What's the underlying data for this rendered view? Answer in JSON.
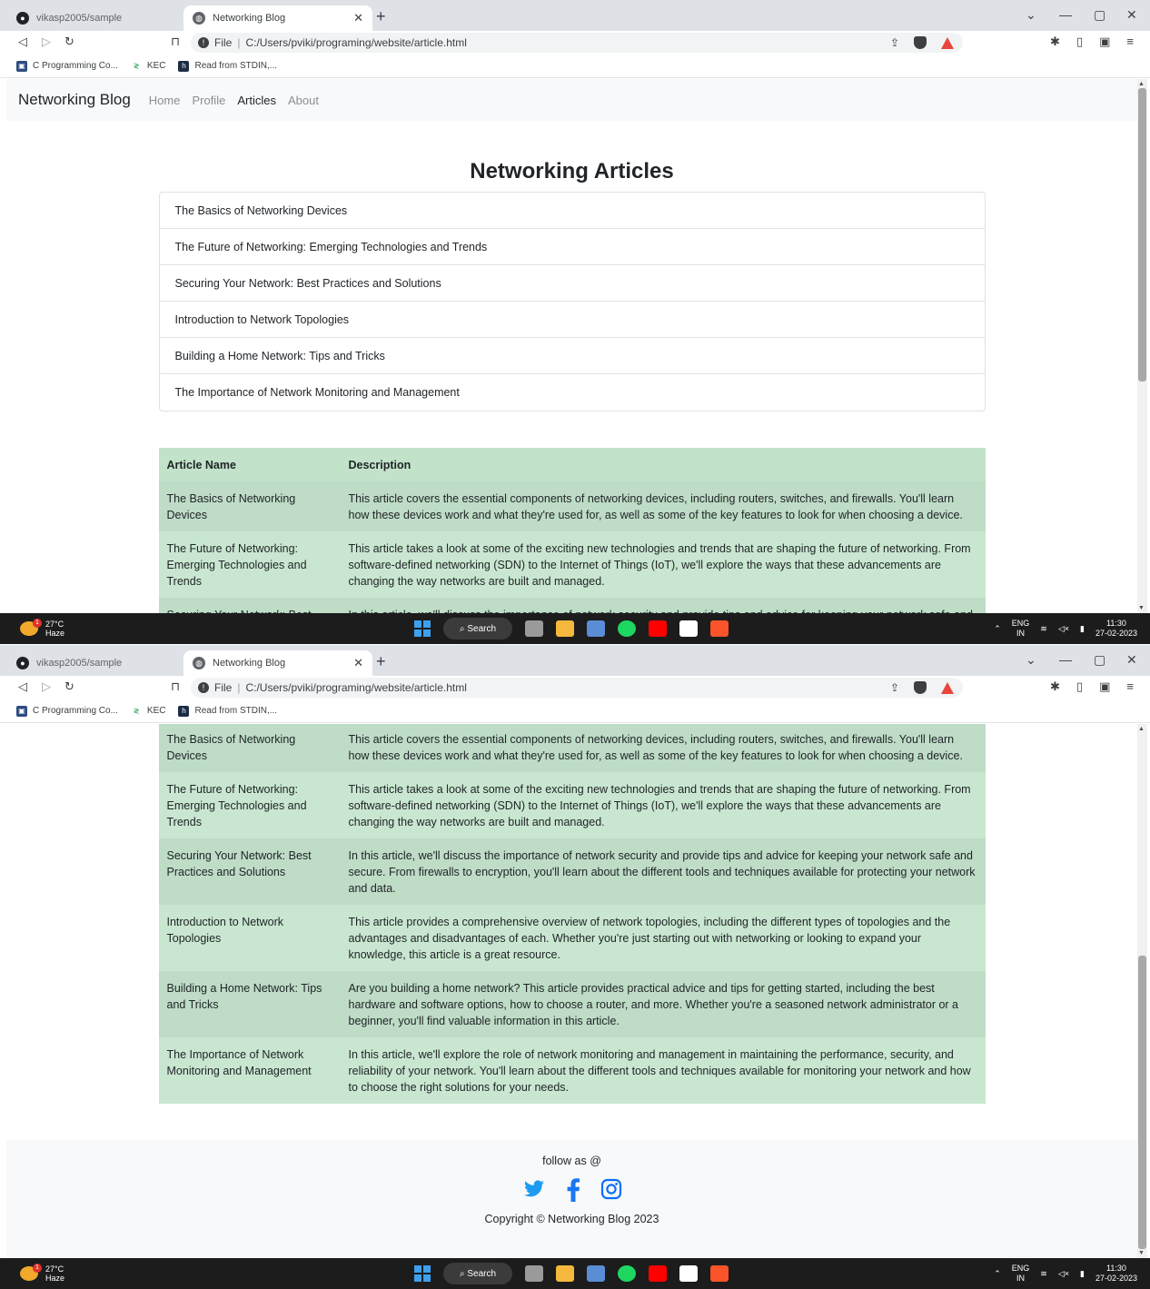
{
  "browser": {
    "tabs": [
      {
        "label": "vikasp2005/sample",
        "active": false
      },
      {
        "label": "Networking Blog",
        "active": true
      }
    ],
    "new_tab": "+",
    "address": {
      "scheme": "File",
      "path": "C:/Users/pviki/programing/website/article.html"
    },
    "bookmarks": [
      {
        "label": "C Programming Co...",
        "icon": "codechef-icon"
      },
      {
        "label": "KEC",
        "icon": "kec-icon"
      },
      {
        "label": "Read from STDIN,...",
        "icon": "hackerrank-icon"
      }
    ]
  },
  "site": {
    "brand": "Networking Blog",
    "nav": [
      "Home",
      "Profile",
      "Articles",
      "About"
    ],
    "active_nav": "Articles",
    "page_title": "Networking Articles",
    "articles": [
      "The Basics of Networking Devices",
      "The Future of Networking: Emerging Technologies and Trends",
      "Securing Your Network: Best Practices and Solutions",
      "Introduction to Network Topologies",
      "Building a Home Network: Tips and Tricks",
      "The Importance of Network Monitoring and Management"
    ],
    "table": {
      "headers": [
        "Article Name",
        "Description"
      ],
      "rows": [
        {
          "name": "The Basics of Networking Devices",
          "desc": "This article covers the essential components of networking devices, including routers, switches, and firewalls. You'll learn how these devices work and what they're used for, as well as some of the key features to look for when choosing a device."
        },
        {
          "name": "The Future of Networking: Emerging Technologies and Trends",
          "desc": "This article takes a look at some of the exciting new technologies and trends that are shaping the future of networking. From software-defined networking (SDN) to the Internet of Things (IoT), we'll explore the ways that these advancements are changing the way networks are built and managed."
        },
        {
          "name": "Securing Your Network: Best Practices and Solutions",
          "desc": "In this article, we'll discuss the importance of network security and provide tips and advice for keeping your network safe and secure. From firewalls to encryption, you'll learn about the different tools and techniques available for protecting your network and data."
        },
        {
          "name": "Introduction to Network Topologies",
          "desc": "This article provides a comprehensive overview of network topologies, including the different types of topologies and the advantages and disadvantages of each. Whether you're just starting out with networking or looking to expand your knowledge, this article is a great resource."
        },
        {
          "name": "Building a Home Network: Tips and Tricks",
          "desc": "Are you building a home network? This article provides practical advice and tips for getting started, including the best hardware and software options, how to choose a router, and more. Whether you're a seasoned network administrator or a beginner, you'll find valuable information in this article."
        },
        {
          "name": "The Importance of Network Monitoring and Management",
          "desc": "In this article, we'll explore the role of network monitoring and management in maintaining the performance, security, and reliability of your network. You'll learn about the different tools and techniques available for monitoring your network and how to choose the right solutions for your needs."
        }
      ]
    },
    "footer": {
      "follow": "follow as @",
      "social": [
        "twitter-icon",
        "facebook-icon",
        "instagram-icon"
      ],
      "copyright": "Copyright © Networking Blog 2023"
    }
  },
  "taskbar": {
    "weather_temp": "27°C",
    "weather_desc": "Haze",
    "weather_badge": "1",
    "search_label": "Search",
    "lang_top": "ENG",
    "lang_bottom": "IN",
    "time": "11:30",
    "date": "27-02-2023"
  },
  "colors": {
    "table_row": "#c9e7d0",
    "table_row_alt": "#bedcc6",
    "twitter": "#1d9bf0",
    "facebook": "#1877f2",
    "instagram": "#0d6efd",
    "brave": "#e8453c"
  },
  "screens": [
    {
      "scroll_fraction": 0.0
    },
    {
      "scroll_fraction": 1.0
    }
  ]
}
